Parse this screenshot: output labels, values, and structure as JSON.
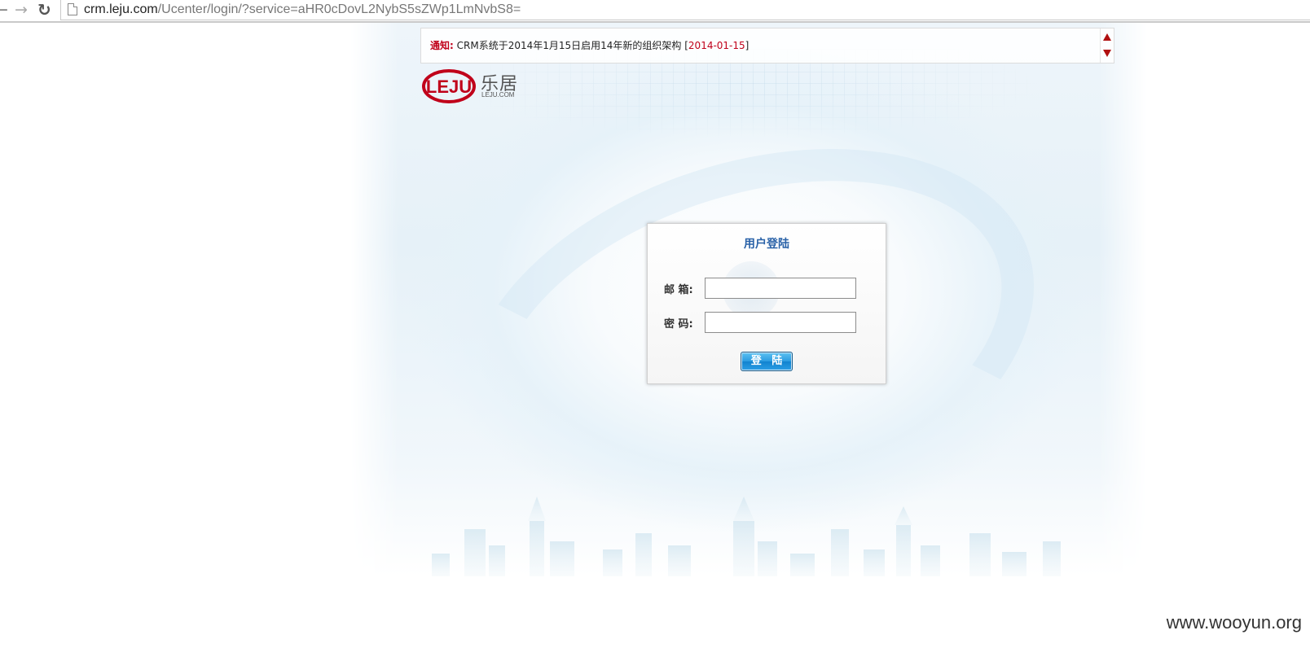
{
  "browser": {
    "url_domain": "crm.leju.com",
    "url_path": "/Ucenter/login/?service=aHR0cDovL2NybS5sZWp1LmNvbS8="
  },
  "notice": {
    "label": "通知:",
    "message": "CRM系统于2014年1月15日启用14年新的组织架构 [",
    "date": "2014-01-15",
    "close_bracket": "]"
  },
  "logo": {
    "name_cn": "乐居",
    "sub": "LEJU.COM",
    "mark_text": "LEJU"
  },
  "login": {
    "title": "用户登陆",
    "email_label": "邮  箱:",
    "password_label": "密  码:",
    "submit_label": "登 陆"
  },
  "watermark": "www.wooyun.org",
  "colors": {
    "brand_red": "#c0001a",
    "title_blue": "#2a62a8",
    "button_blue": "#2a9ae0"
  }
}
